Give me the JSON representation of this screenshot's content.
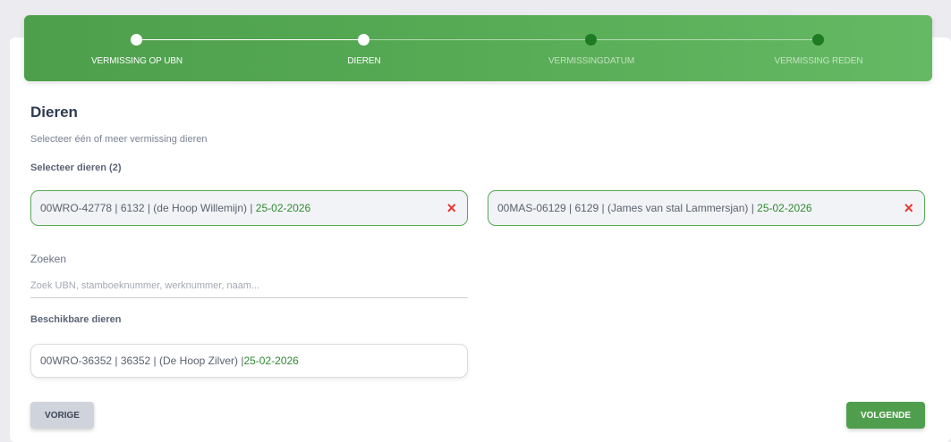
{
  "stepper": {
    "steps": [
      {
        "label": "VERMISSING OP UBN",
        "state": "done"
      },
      {
        "label": "DIEREN",
        "state": "done"
      },
      {
        "label": "VERMISSINGDATUM",
        "state": "todo"
      },
      {
        "label": "VERMISSING REDEN",
        "state": "todo"
      }
    ]
  },
  "header": {
    "title": "Dieren",
    "subtitle": "Selecteer één of meer vermissing dieren"
  },
  "selected": {
    "label": "Selecteer dieren (2)",
    "items": [
      {
        "text": "00WRO-42778 | 6132 | (de Hoop Willemijn) | ",
        "date": "25-02-2026",
        "remove_icon": "×"
      },
      {
        "text": "00MAS-06129 | 6129 | (James van stal Lammersjan) | ",
        "date": "25-02-2026",
        "remove_icon": "×"
      }
    ]
  },
  "search": {
    "label": "Zoeken",
    "placeholder": "Zoek UBN, stamboeknummer, werknummer, naam...",
    "value": ""
  },
  "available": {
    "label": "Beschikbare dieren",
    "items": [
      {
        "text": "00WRO-36352 | 36352 | (De Hoop Zilver) | ",
        "date": "25-02-2026"
      }
    ]
  },
  "buttons": {
    "prev": "VORIGE",
    "next": "VOLGENDE"
  },
  "colors": {
    "accent": "#4f9e4d",
    "date": "#2d8a30",
    "remove": "#e53935"
  }
}
